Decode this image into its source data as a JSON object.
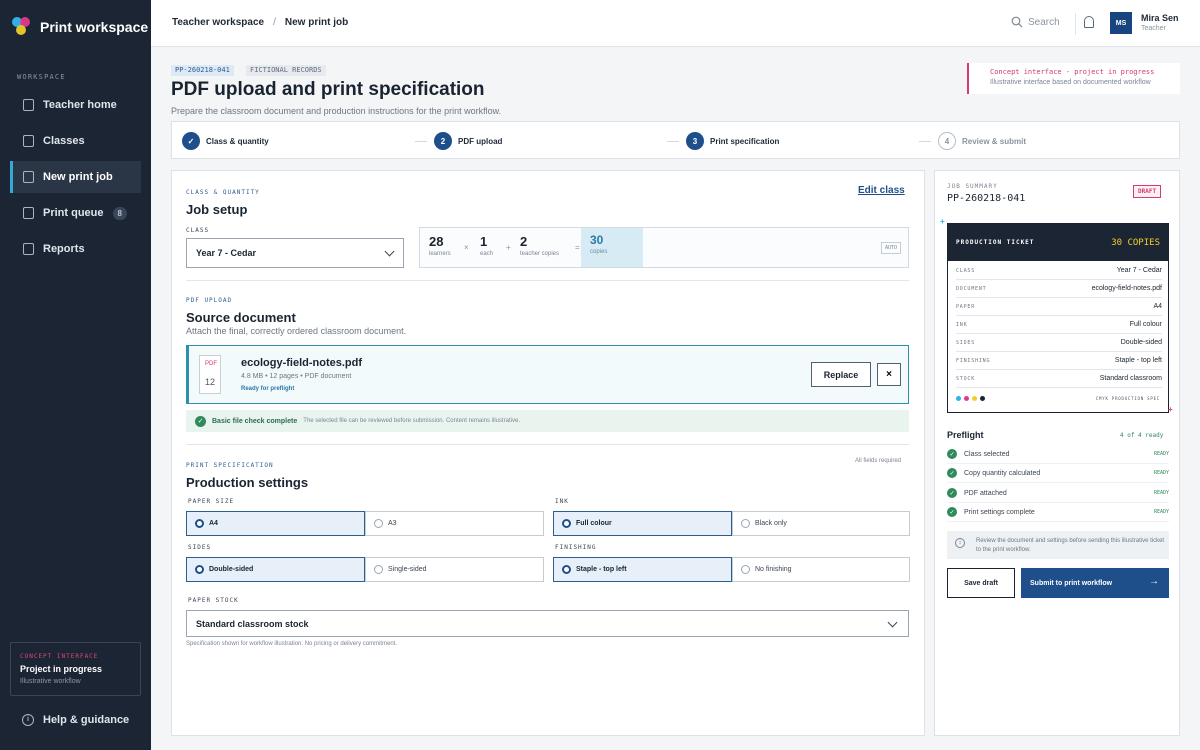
{
  "sidebar": {
    "brand": "Print workspace",
    "section_label": "WORKSPACE",
    "items": [
      {
        "label": "Teacher home"
      },
      {
        "label": "Classes"
      },
      {
        "label": "New print job"
      },
      {
        "label": "Print queue",
        "badge": "8"
      },
      {
        "label": "Reports"
      }
    ],
    "concept": {
      "eyebrow": "CONCEPT INTERFACE",
      "title": "Project in progress",
      "sub": "Illustrative workflow"
    },
    "help": "Help & guidance"
  },
  "topbar": {
    "breadcrumb": [
      "Teacher workspace",
      "New print job"
    ],
    "breadcrumb_sep": "/",
    "search_placeholder": "Search",
    "user": {
      "initials": "MS",
      "name": "Mira Sen",
      "role": "Teacher"
    }
  },
  "header": {
    "job_id_tag": "PP-260218-041",
    "fictional_tag": "FICTIONAL RECORDS",
    "title": "PDF upload and print specification",
    "subtitle": "Prepare the classroom document and production instructions for the print workflow.",
    "notice_title": "Concept interface - project in progress",
    "notice_sub": "Illustrative interface based on documented workflow"
  },
  "stepper": {
    "steps": [
      {
        "num": "✓",
        "label": "Class & quantity",
        "state": "done"
      },
      {
        "num": "2",
        "label": "PDF upload",
        "state": "done"
      },
      {
        "num": "3",
        "label": "Print specification",
        "state": "current"
      },
      {
        "num": "4",
        "label": "Review & submit",
        "state": "todo"
      }
    ]
  },
  "job_setup": {
    "eyebrow": "CLASS & QUANTITY",
    "title": "Job setup",
    "edit_link": "Edit class",
    "class_label": "CLASS",
    "class_value": "Year 7 - Cedar",
    "qty": {
      "learners": {
        "num": "28",
        "label": "learners"
      },
      "times": "×",
      "each": {
        "num": "1",
        "label": "each"
      },
      "plus": "+",
      "teacher": {
        "num": "2",
        "label": "teacher copies"
      },
      "equals": "=",
      "copies": {
        "num": "30",
        "label": "copies"
      },
      "auto": "AUTO"
    }
  },
  "upload": {
    "eyebrow": "PDF UPLOAD",
    "title": "Source document",
    "hint": "Attach the final, correctly ordered classroom document.",
    "file": {
      "type": "PDF",
      "pages_num": "12",
      "name": "ecology-field-notes.pdf",
      "meta": "4.8 MB  •  12 pages  •  PDF document",
      "status": "Ready for preflight"
    },
    "replace_label": "Replace",
    "remove_label": "×",
    "check_title": "Basic file check complete",
    "check_sub": "The selected file can be reviewed before submission. Content remains illustrative."
  },
  "spec": {
    "eyebrow": "PRINT SPECIFICATION",
    "title": "Production settings",
    "required_note": "All fields required",
    "paper_size": {
      "label": "PAPER SIZE",
      "options": [
        "A4",
        "A3"
      ],
      "selected": "A4"
    },
    "ink": {
      "label": "INK",
      "options": [
        "Full colour",
        "Black only"
      ],
      "selected": "Full colour"
    },
    "sides": {
      "label": "SIDES",
      "options": [
        "Double-sided",
        "Single-sided"
      ],
      "selected": "Double-sided"
    },
    "finishing": {
      "label": "FINISHING",
      "options": [
        "Staple - top left",
        "No finishing"
      ],
      "selected": "Staple - top left"
    },
    "stock_label": "PAPER STOCK",
    "stock_value": "Standard classroom stock",
    "footnote": "Specification shown for workflow illustration. No pricing or delivery commitment."
  },
  "summary": {
    "label": "JOB SUMMARY",
    "job_id": "PP-260218-041",
    "status": "DRAFT",
    "ticket": {
      "title": "PRODUCTION TICKET",
      "copies": "30 COPIES",
      "rows": [
        {
          "k": "CLASS",
          "v": "Year 7 - Cedar"
        },
        {
          "k": "DOCUMENT",
          "v": "ecology-field-notes.pdf"
        },
        {
          "k": "PAPER",
          "v": "A4"
        },
        {
          "k": "INK",
          "v": "Full colour"
        },
        {
          "k": "SIDES",
          "v": "Double-sided"
        },
        {
          "k": "FINISHING",
          "v": "Staple - top left"
        },
        {
          "k": "STOCK",
          "v": "Standard classroom"
        }
      ],
      "cmyk_label": "CMYK PRODUCTION SPEC",
      "cmyk_colors": [
        "#2fb1e8",
        "#e43a8e",
        "#f2d02a",
        "#1c2533"
      ]
    },
    "preflight": {
      "title": "Preflight",
      "count": "4 of 4 ready",
      "items": [
        {
          "label": "Class selected",
          "status": "READY"
        },
        {
          "label": "Copy quantity calculated",
          "status": "READY"
        },
        {
          "label": "PDF attached",
          "status": "READY"
        },
        {
          "label": "Print settings complete",
          "status": "READY"
        }
      ]
    },
    "info": "Review the document and settings before sending this illustrative ticket to the print workflow.",
    "save_label": "Save draft",
    "submit_label": "Submit to print workflow",
    "submit_arrow": "→"
  }
}
